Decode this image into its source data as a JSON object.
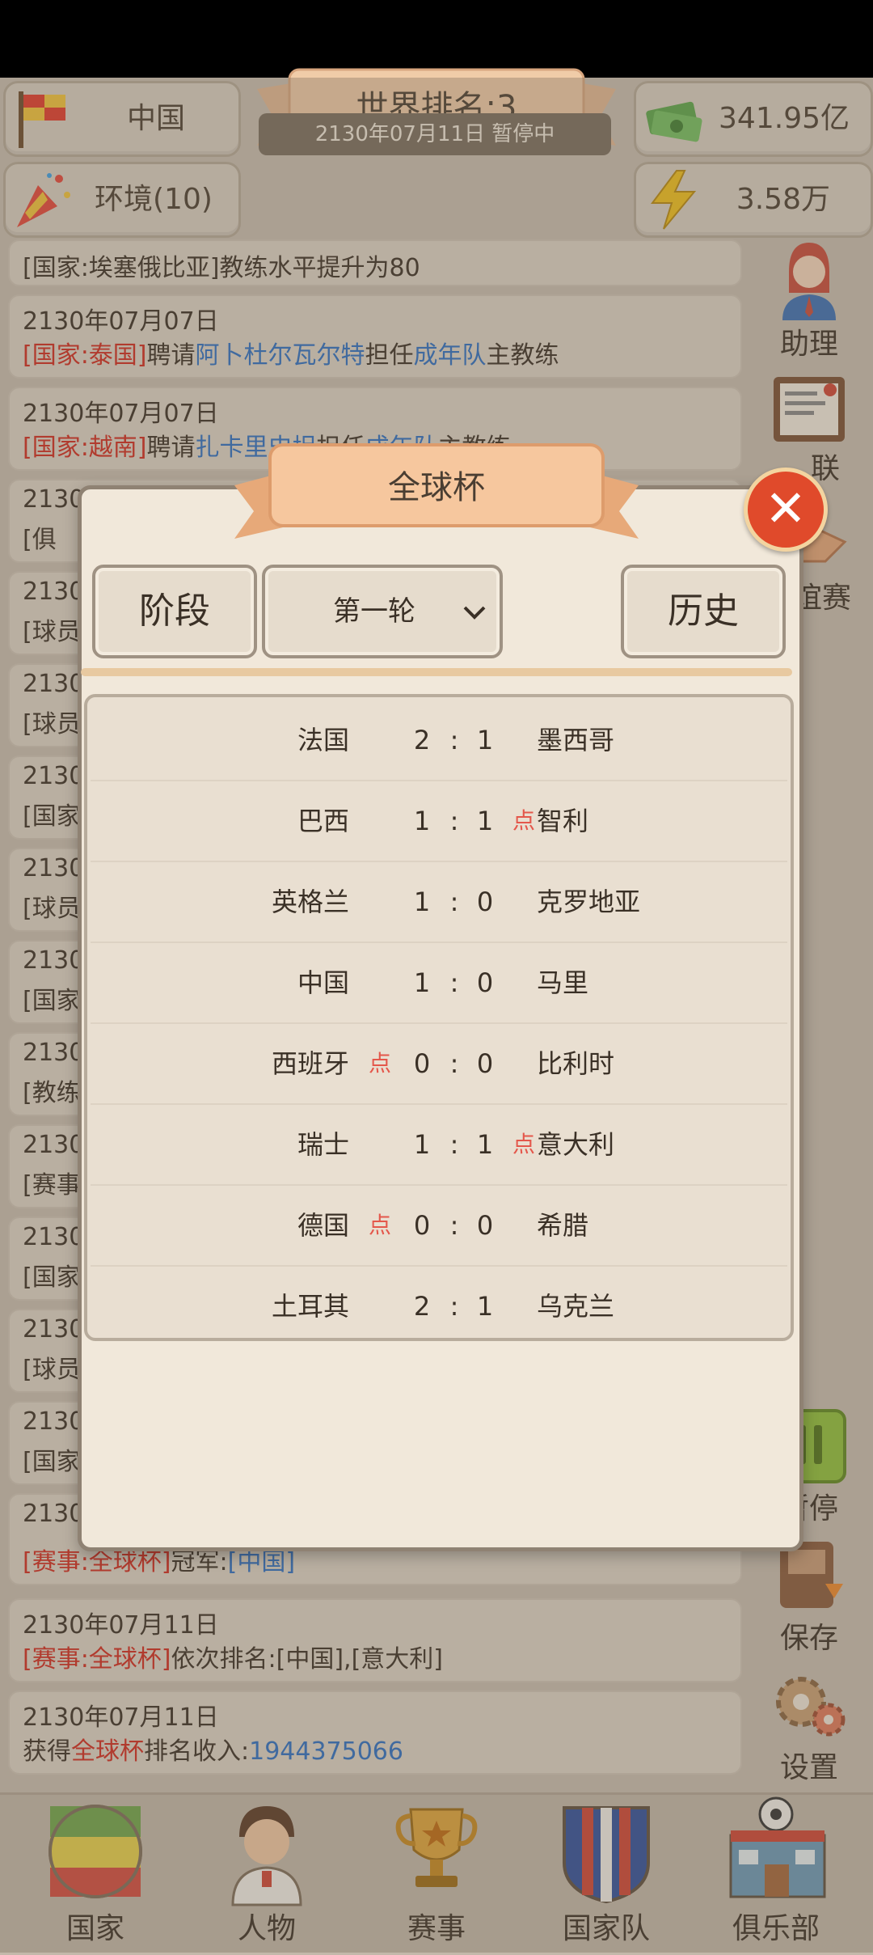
{
  "header": {
    "country": "中国",
    "environment": "环境(10)",
    "world_rank": "世界排名:3",
    "date_status": "2130年07月11日  暂停中",
    "money": "341.95亿",
    "energy": "3.58万"
  },
  "log": [
    {
      "date": "",
      "prefix": "[国家:埃塞俄比亚]",
      "text": "教练水平提升为80"
    },
    {
      "date": "2130年07月07日",
      "prefix": "[国家:泰国]",
      "mid1": "聘请",
      "blue1": "阿卜杜尔瓦尔特",
      "mid2": "担任",
      "blue2": "成年队",
      "tail": "主教练"
    },
    {
      "date": "2130年07月07日",
      "prefix": "[国家:越南]",
      "mid1": "聘请",
      "blue1": "扎卡里史坦",
      "mid2": "担任",
      "blue2": "成年队",
      "tail": "主教练"
    },
    {
      "date": "2130",
      "prefix": "[俱"
    },
    {
      "date": "2130",
      "prefix": "[球员"
    },
    {
      "date": "2130",
      "prefix": "[球员"
    },
    {
      "date": "2130",
      "prefix": "[国家"
    },
    {
      "date": "2130",
      "prefix": "[球员"
    },
    {
      "date": "2130",
      "prefix": "[国家"
    },
    {
      "date": "2130",
      "prefix": "[教练"
    },
    {
      "date": "2130",
      "prefix": "[赛事"
    },
    {
      "date": "2130",
      "prefix": "[国家"
    },
    {
      "date": "2130",
      "prefix": "[球员"
    },
    {
      "date": "2130",
      "prefix": "[国家"
    },
    {
      "date": "2130",
      "prefix": "[赛事:全球杯]",
      "text": "冠军:",
      "blue1": "[中国]"
    },
    {
      "date": "2130年07月11日",
      "prefix": "[赛事:全球杯]",
      "text": "依次排名:[中国],[意大利]"
    },
    {
      "date": "2130年07月11日",
      "mid1": "获得",
      "red1": "全球杯",
      "mid2": "排名收入:",
      "blue1": "1944375066"
    }
  ],
  "right_menu": {
    "assistant": "助理",
    "league": "联",
    "friendly": "谊赛",
    "pause": "暂停",
    "save": "保存",
    "settings": "设置"
  },
  "bottom_nav": [
    "国家",
    "人物",
    "赛事",
    "国家队",
    "俱乐部"
  ],
  "modal": {
    "title": "全球杯",
    "stage_label": "阶段",
    "round_selected": "第一轮",
    "history_label": "历史",
    "matches": [
      {
        "home": "法国",
        "home_pen": "",
        "s1": "2",
        "s2": "1",
        "away_pen": "",
        "away": "墨西哥"
      },
      {
        "home": "巴西",
        "home_pen": "",
        "s1": "1",
        "s2": "1",
        "away_pen": "点",
        "away": "智利"
      },
      {
        "home": "英格兰",
        "home_pen": "",
        "s1": "1",
        "s2": "0",
        "away_pen": "",
        "away": "克罗地亚"
      },
      {
        "home": "中国",
        "home_pen": "",
        "s1": "1",
        "s2": "0",
        "away_pen": "",
        "away": "马里"
      },
      {
        "home": "西班牙",
        "home_pen": "点",
        "s1": "0",
        "s2": "0",
        "away_pen": "",
        "away": "比利时"
      },
      {
        "home": "瑞士",
        "home_pen": "",
        "s1": "1",
        "s2": "1",
        "away_pen": "点",
        "away": "意大利"
      },
      {
        "home": "德国",
        "home_pen": "点",
        "s1": "0",
        "s2": "0",
        "away_pen": "",
        "away": "希腊"
      },
      {
        "home": "土耳其",
        "home_pen": "",
        "s1": "2",
        "s2": "1",
        "away_pen": "",
        "away": "乌克兰"
      }
    ],
    "score_colon": ":"
  },
  "colors": {
    "accent_red": "#d12a1e",
    "link_blue": "#2b6fc4",
    "close_red": "#e04a2b"
  }
}
